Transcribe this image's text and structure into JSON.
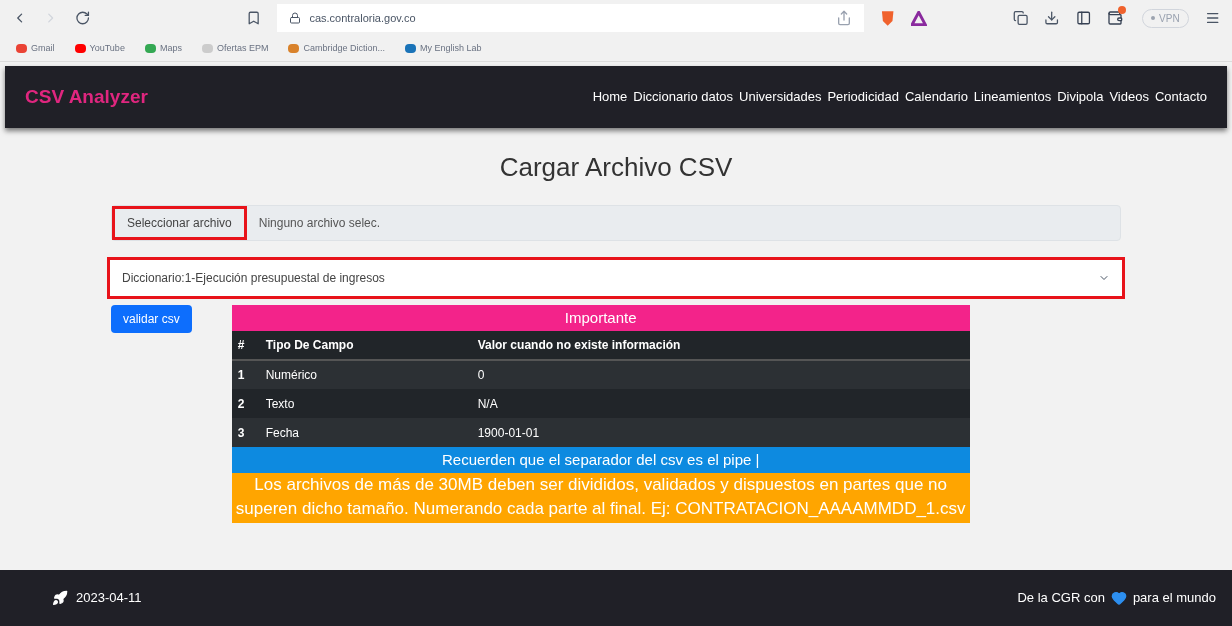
{
  "browser": {
    "url": "cas.contraloria.gov.co",
    "vpn": "VPN",
    "bookmarks": [
      {
        "label": "Gmail",
        "color": "#ea4335"
      },
      {
        "label": "YouTube",
        "color": "#ff0000"
      },
      {
        "label": "Maps",
        "color": "#34a853"
      },
      {
        "label": "Ofertas EPM",
        "color": "#cccccc"
      },
      {
        "label": "Cambridge Diction...",
        "color": "#d9822b"
      },
      {
        "label": "My English Lab",
        "color": "#1a73b8"
      }
    ]
  },
  "navbar": {
    "brand": "CSV Analyzer",
    "links": [
      "Home",
      "Diccionario datos",
      "Universidades",
      "Periodicidad",
      "Calendario",
      "Lineamientos",
      "Divipola",
      "Videos",
      "Contacto"
    ]
  },
  "page_title": "Cargar Archivo CSV",
  "file_input": {
    "button": "Seleccionar archivo",
    "value": "Ninguno archivo selec.",
    "highlighted": true
  },
  "dictionary_select": {
    "value": "Diccionario:1-Ejecución presupuestal de ingresos",
    "highlighted": true
  },
  "validate_button": "validar csv",
  "info_table": {
    "title": "Importante",
    "columns": [
      "#",
      "Tipo De Campo",
      "Valor cuando no existe información"
    ],
    "rows": [
      [
        "1",
        "Numérico",
        "0"
      ],
      [
        "2",
        "Texto",
        "N/A"
      ],
      [
        "3",
        "Fecha",
        "1900-01-01"
      ]
    ],
    "separator_note": "Recuerden que el separador del csv es el pipe |",
    "size_note": "Los archivos de más de 30MB deben ser divididos, validados y dispuestos en partes que no superen dicho tamaño. Numerando cada parte al final. Ej: CONTRATACION_AAAAMMDD_1.csv"
  },
  "footer": {
    "date": "2023-04-11",
    "credit_before": "De la CGR con",
    "credit_after": "para el mundo"
  }
}
